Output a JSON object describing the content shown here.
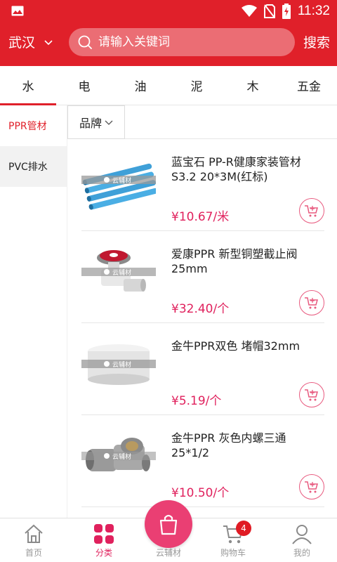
{
  "status_bar": {
    "time": "11:32"
  },
  "header": {
    "city": "武汉",
    "search_placeholder": "请输入关键词",
    "search_button": "搜索"
  },
  "category_tabs": [
    {
      "label": "水",
      "active": true
    },
    {
      "label": "电"
    },
    {
      "label": "油"
    },
    {
      "label": "泥"
    },
    {
      "label": "木"
    },
    {
      "label": "五金"
    }
  ],
  "sidebar": {
    "items": [
      {
        "label": "PPR管材",
        "active": true
      },
      {
        "label": "PVC排水"
      }
    ]
  },
  "filter": {
    "brand_label": "品牌"
  },
  "watermark": "云辅材",
  "products": [
    {
      "name": "蓝宝石 PP-R健康家装管材S3.2 20*3M(红标)",
      "price": "¥10.67/米"
    },
    {
      "name": "爱康PPR 新型铜塑截止阀25mm",
      "price": "¥32.40/个"
    },
    {
      "name": "金牛PPR双色 堵帽32mm",
      "price": "¥5.19/个"
    },
    {
      "name": "金牛PPR 灰色内螺三通25*1/2",
      "price": "¥10.50/个"
    }
  ],
  "bottom_nav": {
    "items": [
      {
        "label": "首页",
        "icon": "home-icon"
      },
      {
        "label": "分类",
        "icon": "category-icon",
        "active": true
      },
      {
        "label": "云辅材",
        "icon": "shopping-bag-icon"
      },
      {
        "label": "购物车",
        "icon": "cart-icon"
      },
      {
        "label": "我的",
        "icon": "profile-icon"
      }
    ],
    "cart_badge": "4"
  },
  "colors": {
    "brand_red": "#e0202a",
    "price_pink": "#e0215d",
    "fab_pink": "#ea3f73"
  }
}
